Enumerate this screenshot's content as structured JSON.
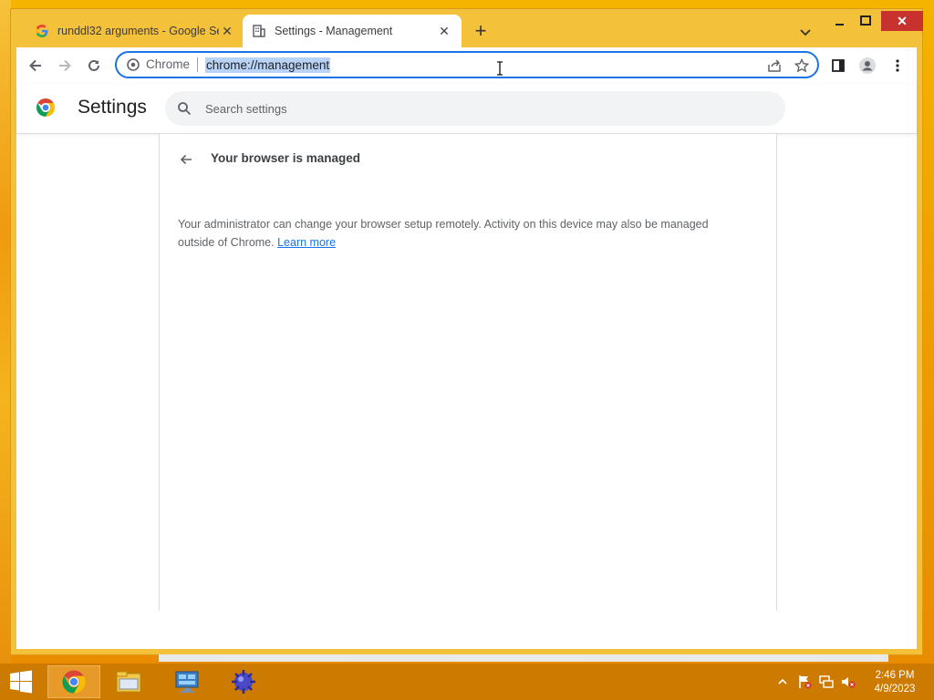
{
  "colors": {
    "accent": "#1a73e8",
    "close_button": "#c7322e",
    "taskbar": "#cc7a00",
    "window_frame": "#f4c13b"
  },
  "tabs": [
    {
      "title": "runddl32 arguments - Google Se",
      "icon": "google-g-icon",
      "active": false
    },
    {
      "title": "Settings - Management",
      "icon": "document-building-icon",
      "active": true
    }
  ],
  "omnibox": {
    "chip": "Chrome",
    "url": "chrome://management"
  },
  "settings": {
    "title": "Settings",
    "search_placeholder": "Search settings"
  },
  "page": {
    "title": "Your browser is managed",
    "description": "Your administrator can change your browser setup remotely. Activity on this device may also be managed outside of Chrome.",
    "learn_more": "Learn more"
  },
  "taskbar": {
    "apps": [
      "chrome-icon",
      "file-explorer-icon",
      "control-panel-icon",
      "app-icon"
    ],
    "time": "2:46 PM",
    "date": "4/9/2023"
  }
}
